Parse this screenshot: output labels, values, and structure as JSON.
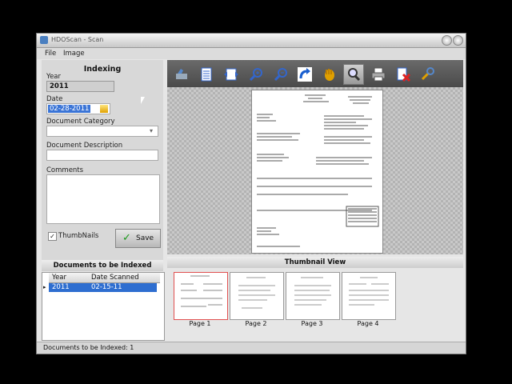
{
  "window": {
    "title": "HDOScan - Scan"
  },
  "menu": [
    "File",
    "Image"
  ],
  "indexing": {
    "heading": "Indexing",
    "year_label": "Year",
    "year_value": "2011",
    "date_label": "Date",
    "date_value": "02-28-2011",
    "category_label": "Document Category",
    "category_value": "",
    "description_label": "Document Description",
    "description_value": "",
    "comments_label": "Comments",
    "comments_value": "",
    "thumbnails_label": "ThumbNails",
    "thumbnails_checked": true,
    "save_label": "Save"
  },
  "toolbar": {
    "icons": [
      "scan-icon",
      "page-list-icon",
      "fit-width-icon",
      "zoom-in-icon",
      "zoom-out-icon",
      "rotate-icon",
      "pan-hand-icon",
      "magnifier-icon",
      "print-icon",
      "delete-page-icon",
      "settings-icon"
    ],
    "active": "magnifier-icon"
  },
  "thumbnail_view": {
    "heading": "Thumbnail View",
    "pages": [
      "Page 1",
      "Page 2",
      "Page 3",
      "Page 4"
    ],
    "selected_index": 0
  },
  "documents_to_index": {
    "heading": "Documents to be Indexed",
    "columns": [
      "Year",
      "Date Scanned"
    ],
    "rows": [
      [
        "2011",
        "02-15-11"
      ]
    ]
  },
  "status": {
    "text": "Documents to be Indexed: 1"
  },
  "colors": {
    "selection": "#2e6ed0",
    "thumb_selected_border": "#e05050"
  }
}
